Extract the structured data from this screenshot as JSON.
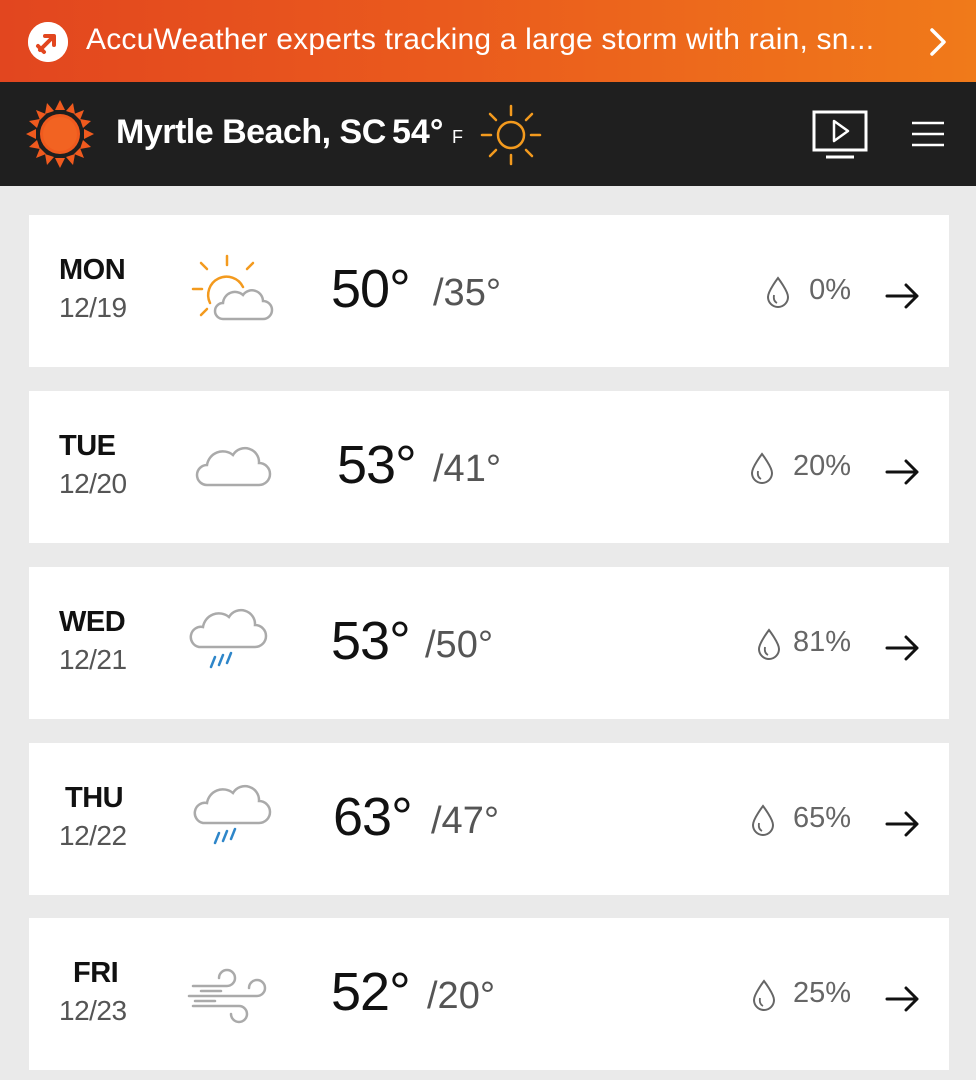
{
  "banner": {
    "text": "AccuWeather experts tracking a large storm with rain, sn...",
    "icon": "accuweather-alert-arrow-icon",
    "chevron_icon": "chevron-right-icon"
  },
  "header": {
    "location": "Myrtle Beach, SC",
    "current_temp": "54°",
    "unit": "F",
    "logo_icon": "accuweather-sun-logo-icon",
    "condition_icon": "sunny-icon",
    "video_icon": "video-play-icon",
    "menu_icon": "hamburger-menu-icon"
  },
  "colors": {
    "banner_start": "#e2461f",
    "banner_end": "#f07a1a",
    "header_bg": "#1f1f1f",
    "accent_orange": "#f39a1e",
    "rain_blue": "#2e86c9",
    "page_bg": "#eaeaea"
  },
  "forecast": [
    {
      "day": "MON",
      "date": "12/19",
      "high": "50°",
      "low": "/35°",
      "precip": "0%",
      "icon": "partly-sunny-icon"
    },
    {
      "day": "TUE",
      "date": "12/20",
      "high": "53°",
      "low": "/41°",
      "precip": "20%",
      "icon": "cloudy-icon"
    },
    {
      "day": "WED",
      "date": "12/21",
      "high": "53°",
      "low": "/50°",
      "precip": "81%",
      "icon": "rain-icon"
    },
    {
      "day": "THU",
      "date": "12/22",
      "high": "63°",
      "low": "/47°",
      "precip": "65%",
      "icon": "rain-icon"
    },
    {
      "day": "FRI",
      "date": "12/23",
      "high": "52°",
      "low": "/20°",
      "precip": "25%",
      "icon": "windy-icon"
    }
  ]
}
